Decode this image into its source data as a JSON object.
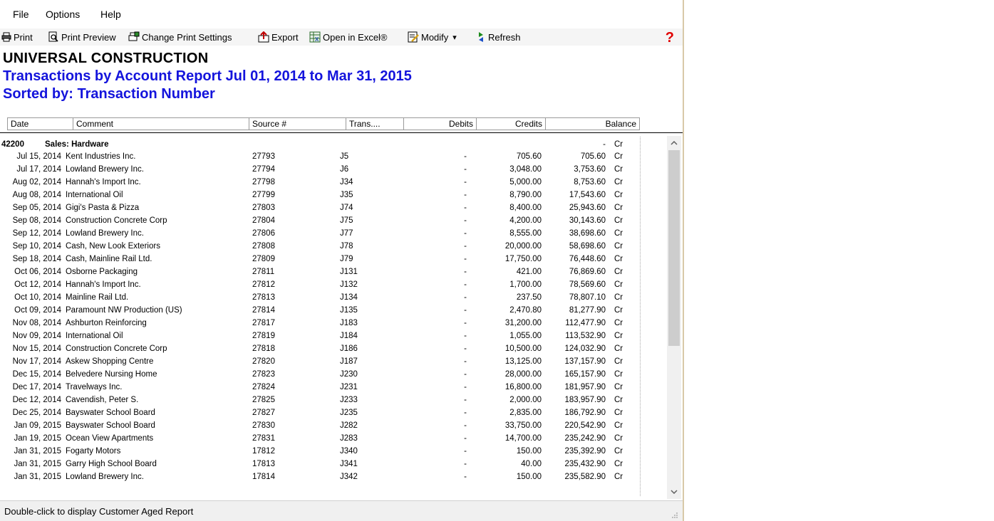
{
  "menu": [
    "File",
    "Options",
    "Help"
  ],
  "toolbar": {
    "print": "Print",
    "print_preview": "Print Preview",
    "change_print_settings": "Change Print Settings",
    "export": "Export",
    "open_in_excel": "Open in Excel®",
    "modify": "Modify",
    "modify_arrow": "▾",
    "refresh": "Refresh",
    "help": "?"
  },
  "header": {
    "company": "UNIVERSAL CONSTRUCTION",
    "title": "Transactions by Account Report Jul 01, 2014 to Mar 31, 2015",
    "sorted": "Sorted by: Transaction Number"
  },
  "columns": [
    "Date",
    "Comment",
    "Source #",
    "Trans....",
    "Debits",
    "Credits",
    "Balance"
  ],
  "account": {
    "number": "42200",
    "name": "Sales: Hardware",
    "opening_debit": "-",
    "opening_crdr": "Cr"
  },
  "rows": [
    {
      "date": "Jul 15, 2014",
      "comment": "Kent Industries Inc.",
      "source": "27793",
      "trans": "J5",
      "debits": "-",
      "credits": "705.60",
      "balance": "705.60",
      "crdr": "Cr"
    },
    {
      "date": "Jul 17, 2014",
      "comment": "Lowland Brewery Inc.",
      "source": "27794",
      "trans": "J6",
      "debits": "-",
      "credits": "3,048.00",
      "balance": "3,753.60",
      "crdr": "Cr"
    },
    {
      "date": "Aug 02, 2014",
      "comment": "Hannah's Import Inc.",
      "source": "27798",
      "trans": "J34",
      "debits": "-",
      "credits": "5,000.00",
      "balance": "8,753.60",
      "crdr": "Cr"
    },
    {
      "date": "Aug 08, 2014",
      "comment": "International Oil",
      "source": "27799",
      "trans": "J35",
      "debits": "-",
      "credits": "8,790.00",
      "balance": "17,543.60",
      "crdr": "Cr"
    },
    {
      "date": "Sep 05, 2014",
      "comment": "Gigi's Pasta & Pizza",
      "source": "27803",
      "trans": "J74",
      "debits": "-",
      "credits": "8,400.00",
      "balance": "25,943.60",
      "crdr": "Cr"
    },
    {
      "date": "Sep 08, 2014",
      "comment": "Construction Concrete Corp",
      "source": "27804",
      "trans": "J75",
      "debits": "-",
      "credits": "4,200.00",
      "balance": "30,143.60",
      "crdr": "Cr"
    },
    {
      "date": "Sep 12, 2014",
      "comment": "Lowland Brewery Inc.",
      "source": "27806",
      "trans": "J77",
      "debits": "-",
      "credits": "8,555.00",
      "balance": "38,698.60",
      "crdr": "Cr"
    },
    {
      "date": "Sep 10, 2014",
      "comment": "Cash, New Look Exteriors",
      "source": "27808",
      "trans": "J78",
      "debits": "-",
      "credits": "20,000.00",
      "balance": "58,698.60",
      "crdr": "Cr"
    },
    {
      "date": "Sep 18, 2014",
      "comment": "Cash, Mainline Rail Ltd.",
      "source": "27809",
      "trans": "J79",
      "debits": "-",
      "credits": "17,750.00",
      "balance": "76,448.60",
      "crdr": "Cr"
    },
    {
      "date": "Oct 06, 2014",
      "comment": "Osborne Packaging",
      "source": "27811",
      "trans": "J131",
      "debits": "-",
      "credits": "421.00",
      "balance": "76,869.60",
      "crdr": "Cr"
    },
    {
      "date": "Oct 12, 2014",
      "comment": "Hannah's Import Inc.",
      "source": "27812",
      "trans": "J132",
      "debits": "-",
      "credits": "1,700.00",
      "balance": "78,569.60",
      "crdr": "Cr"
    },
    {
      "date": "Oct 10, 2014",
      "comment": "Mainline Rail Ltd.",
      "source": "27813",
      "trans": "J134",
      "debits": "-",
      "credits": "237.50",
      "balance": "78,807.10",
      "crdr": "Cr"
    },
    {
      "date": "Oct 09, 2014",
      "comment": "Paramount NW Production (US)",
      "source": "27814",
      "trans": "J135",
      "debits": "-",
      "credits": "2,470.80",
      "balance": "81,277.90",
      "crdr": "Cr"
    },
    {
      "date": "Nov 08, 2014",
      "comment": "Ashburton Reinforcing",
      "source": "27817",
      "trans": "J183",
      "debits": "-",
      "credits": "31,200.00",
      "balance": "112,477.90",
      "crdr": "Cr"
    },
    {
      "date": "Nov 09, 2014",
      "comment": "International Oil",
      "source": "27819",
      "trans": "J184",
      "debits": "-",
      "credits": "1,055.00",
      "balance": "113,532.90",
      "crdr": "Cr"
    },
    {
      "date": "Nov 15, 2014",
      "comment": "Construction Concrete Corp",
      "source": "27818",
      "trans": "J186",
      "debits": "-",
      "credits": "10,500.00",
      "balance": "124,032.90",
      "crdr": "Cr"
    },
    {
      "date": "Nov 17, 2014",
      "comment": "Askew Shopping Centre",
      "source": "27820",
      "trans": "J187",
      "debits": "-",
      "credits": "13,125.00",
      "balance": "137,157.90",
      "crdr": "Cr"
    },
    {
      "date": "Dec 15, 2014",
      "comment": "Belvedere Nursing Home",
      "source": "27823",
      "trans": "J230",
      "debits": "-",
      "credits": "28,000.00",
      "balance": "165,157.90",
      "crdr": "Cr"
    },
    {
      "date": "Dec 17, 2014",
      "comment": "Travelways Inc.",
      "source": "27824",
      "trans": "J231",
      "debits": "-",
      "credits": "16,800.00",
      "balance": "181,957.90",
      "crdr": "Cr"
    },
    {
      "date": "Dec 12, 2014",
      "comment": "Cavendish, Peter S.",
      "source": "27825",
      "trans": "J233",
      "debits": "-",
      "credits": "2,000.00",
      "balance": "183,957.90",
      "crdr": "Cr"
    },
    {
      "date": "Dec 25, 2014",
      "comment": "Bayswater School Board",
      "source": "27827",
      "trans": "J235",
      "debits": "-",
      "credits": "2,835.00",
      "balance": "186,792.90",
      "crdr": "Cr"
    },
    {
      "date": "Jan 09, 2015",
      "comment": "Bayswater School Board",
      "source": "27830",
      "trans": "J282",
      "debits": "-",
      "credits": "33,750.00",
      "balance": "220,542.90",
      "crdr": "Cr"
    },
    {
      "date": "Jan 19, 2015",
      "comment": "Ocean View Apartments",
      "source": "27831",
      "trans": "J283",
      "debits": "-",
      "credits": "14,700.00",
      "balance": "235,242.90",
      "crdr": "Cr"
    },
    {
      "date": "Jan 31, 2015",
      "comment": "Fogarty Motors",
      "source": "17812",
      "trans": "J340",
      "debits": "-",
      "credits": "150.00",
      "balance": "235,392.90",
      "crdr": "Cr"
    },
    {
      "date": "Jan 31, 2015",
      "comment": "Garry High School Board",
      "source": "17813",
      "trans": "J341",
      "debits": "-",
      "credits": "40.00",
      "balance": "235,432.90",
      "crdr": "Cr"
    },
    {
      "date": "Jan 31, 2015",
      "comment": "Lowland Brewery Inc.",
      "source": "17814",
      "trans": "J342",
      "debits": "-",
      "credits": "150.00",
      "balance": "235,582.90",
      "crdr": "Cr"
    }
  ],
  "status": "Double-click to display Customer Aged Report",
  "colors": {
    "title_blue": "#1414dc",
    "help_red": "#e00000"
  }
}
